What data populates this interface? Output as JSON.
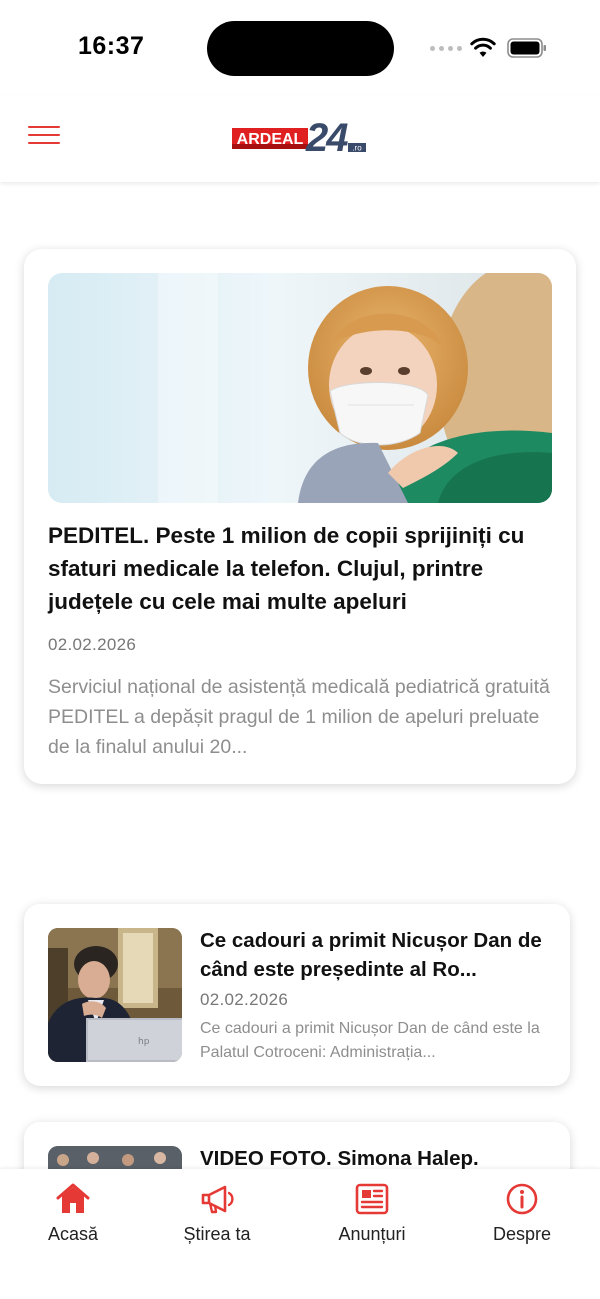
{
  "status_bar": {
    "time": "16:37"
  },
  "header": {
    "logo": {
      "brand": "ARDEAL",
      "number": "24",
      "suffix": ".ro"
    },
    "accent_color": "#e53935"
  },
  "featured_article": {
    "title": "PEDITEL. Peste 1 milion de copii sprijiniți cu sfaturi medicale la telefon. Clujul, printre județele cu cele mai multe apeluri",
    "date": "02.02.2026",
    "excerpt": "Serviciul național de asistență medicală pediatrică gratuită PEDITEL a depășit pragul de 1 milion de apeluri preluate de la finalul anului 20..."
  },
  "articles": [
    {
      "title": "Ce cadouri a primit Nicușor Dan de când este președinte al Ro...",
      "date": "02.02.2026",
      "excerpt": "Ce cadouri a primit Nicușor Dan de când este la Palatul Cotroceni: Administrația..."
    },
    {
      "title": "VIDEO FOTO. Simona Halep.",
      "date": "",
      "excerpt": ""
    }
  ],
  "tab_bar": {
    "tabs": [
      {
        "label": "Acasă",
        "icon": "home-icon",
        "active": true
      },
      {
        "label": "Știrea ta",
        "icon": "megaphone-icon",
        "active": false
      },
      {
        "label": "Anunțuri",
        "icon": "newspaper-icon",
        "active": false
      },
      {
        "label": "Despre",
        "icon": "info-icon",
        "active": false
      }
    ],
    "icon_color": "#e53935"
  }
}
